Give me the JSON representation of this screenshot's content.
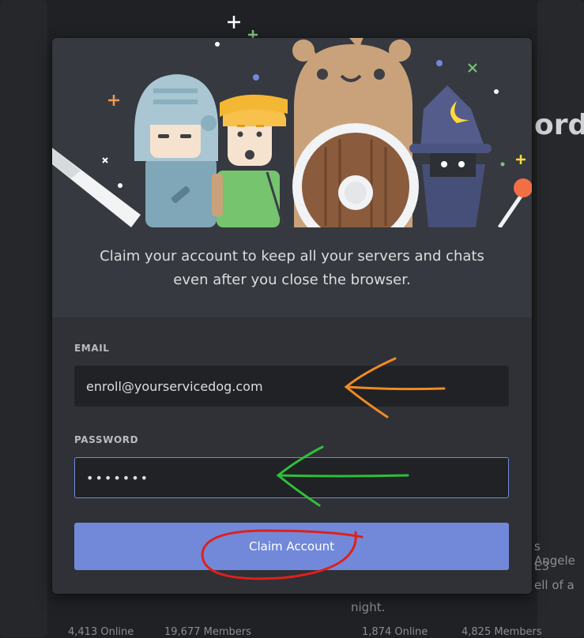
{
  "background": {
    "title_fragment": "ord",
    "left_stats": [
      "4,413 Online",
      "19,677 Members"
    ],
    "right_stats": [
      "1,874 Online",
      "4,825 Members"
    ],
    "right_snippets": [
      "s Angele",
      "E3",
      "ell of a",
      "night."
    ]
  },
  "modal": {
    "subtitle_line1": "Claim your account to keep all your servers and chats",
    "subtitle_line2": "even after you close the browser.",
    "email_label": "EMAIL",
    "email_value": "enroll@yourservicedog.com",
    "password_label": "PASSWORD",
    "password_value": "•••••••",
    "claim_button": "Claim Account"
  },
  "colors": {
    "accent": "#7289da",
    "modal_bg": "#36393f",
    "form_bg": "#2f3136",
    "input_bg": "#202225",
    "annotation_orange": "#f08a24",
    "annotation_green": "#2fbf3a",
    "annotation_red": "#e0201c"
  }
}
